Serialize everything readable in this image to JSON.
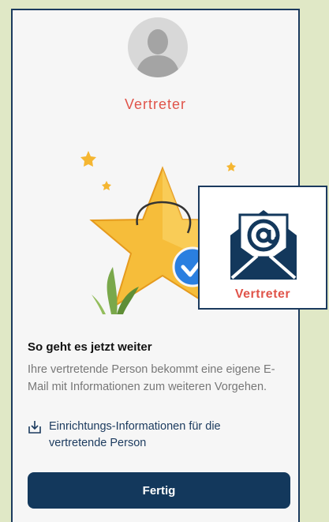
{
  "header": {
    "role_title": "Vertreter"
  },
  "main": {
    "heading": "So geht es jetzt weiter",
    "description": "Ihre vertretende Person bekommt eine eigene E-Mail mit Informationen zum weiteren Vorgehen.",
    "info_link": "Einrichtungs-Informationen für die vertretende Person",
    "done_label": "Fertig"
  },
  "overlay": {
    "label": "Vertreter",
    "icon": "email-at-icon"
  },
  "colors": {
    "accent_red": "#e0544a",
    "primary_navy": "#13385c",
    "background": "#e0e8c6"
  }
}
